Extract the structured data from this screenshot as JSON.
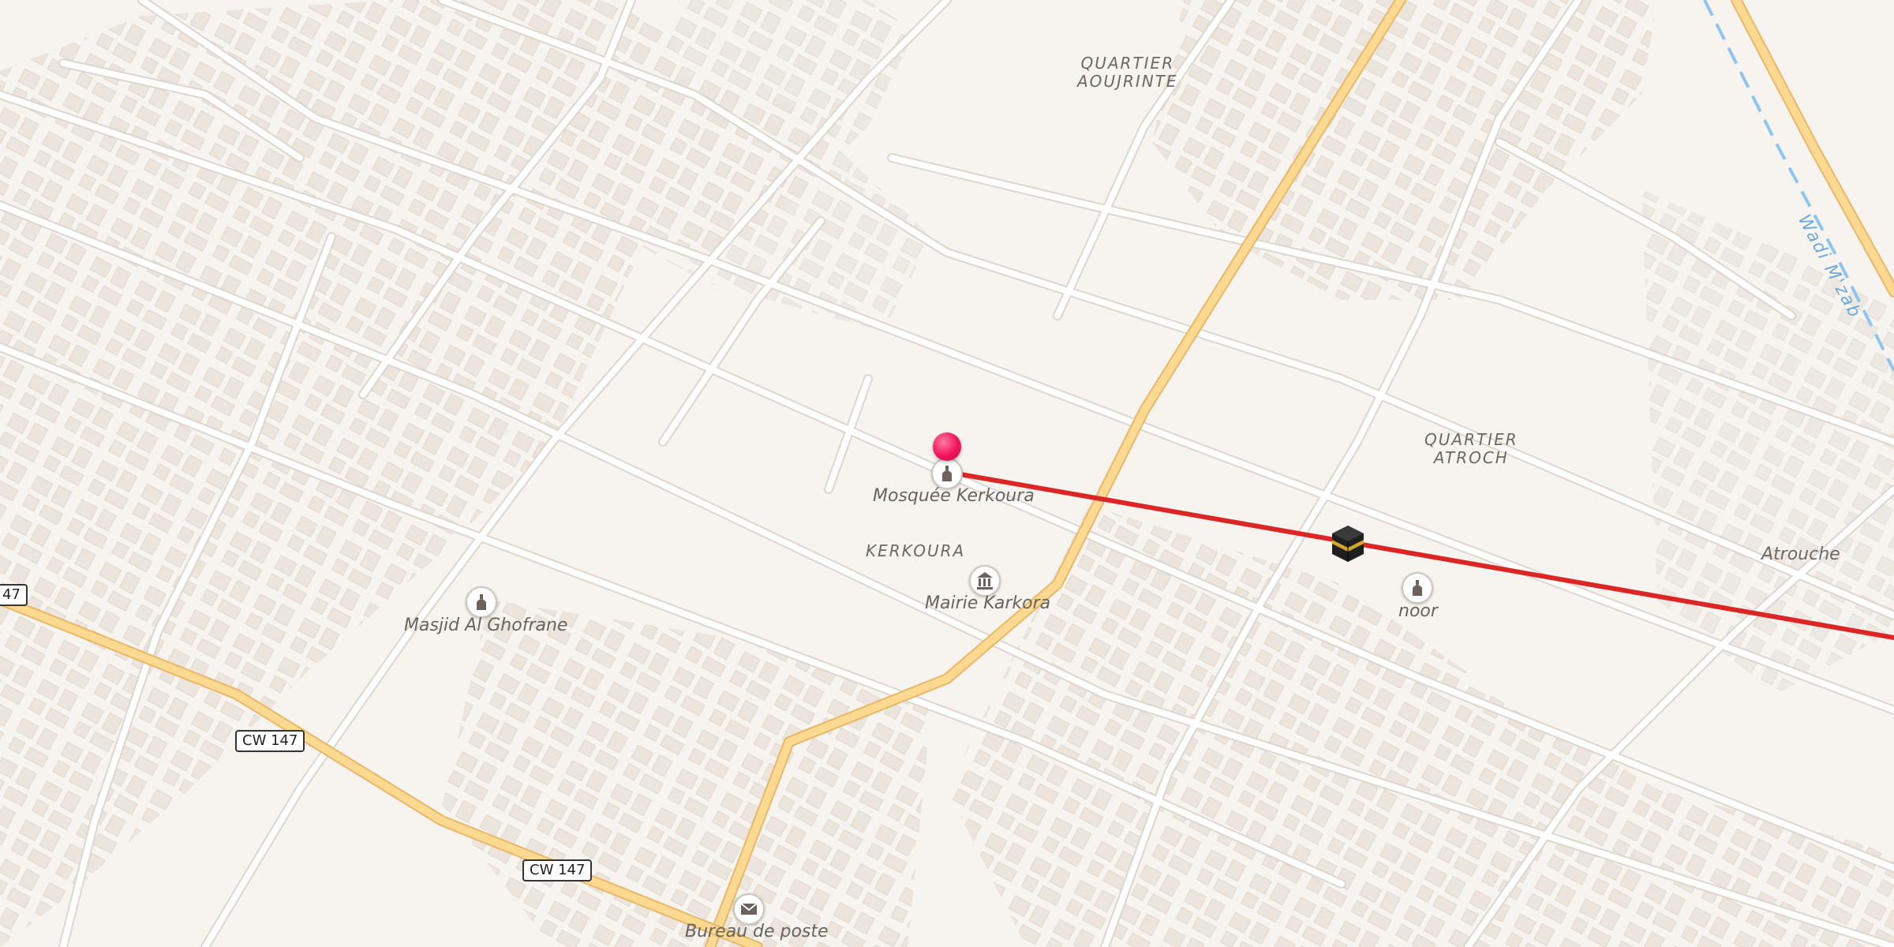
{
  "map": {
    "colors": {
      "background": "#f7f4f0",
      "building": "#ece6df",
      "minor_road": "#ffffff",
      "major_road": "#fbd990",
      "major_road_casing": "#e8b769",
      "route_line": "#dc2626",
      "river": "#8ec5ef",
      "pin": "#f0135a"
    },
    "districts": [
      {
        "line1": "QUARTIER",
        "line2": "AOUJRINTE"
      },
      {
        "line1": "QUARTIER",
        "line2": "ATROCH"
      },
      {
        "line1": "KERKOURA",
        "line2": ""
      }
    ],
    "places": {
      "atrouche": "Atrouche",
      "wadi": "Wadi M'zab"
    },
    "pois": [
      {
        "name": "Mosquée Kerkoura",
        "icon": "mosque-icon"
      },
      {
        "name": "Mairie Karkora",
        "icon": "town-hall-icon"
      },
      {
        "name": "Masjid Al Ghofrane",
        "icon": "mosque-icon"
      },
      {
        "name": "noor",
        "icon": "mosque-icon"
      },
      {
        "name": "Bureau de poste",
        "icon": "post-office-icon"
      }
    ],
    "shields": [
      "47",
      "CW 147",
      "CW 147"
    ],
    "markers": {
      "pin_icon": "location-pin-icon",
      "qibla_icon": "kaaba-icon"
    }
  }
}
